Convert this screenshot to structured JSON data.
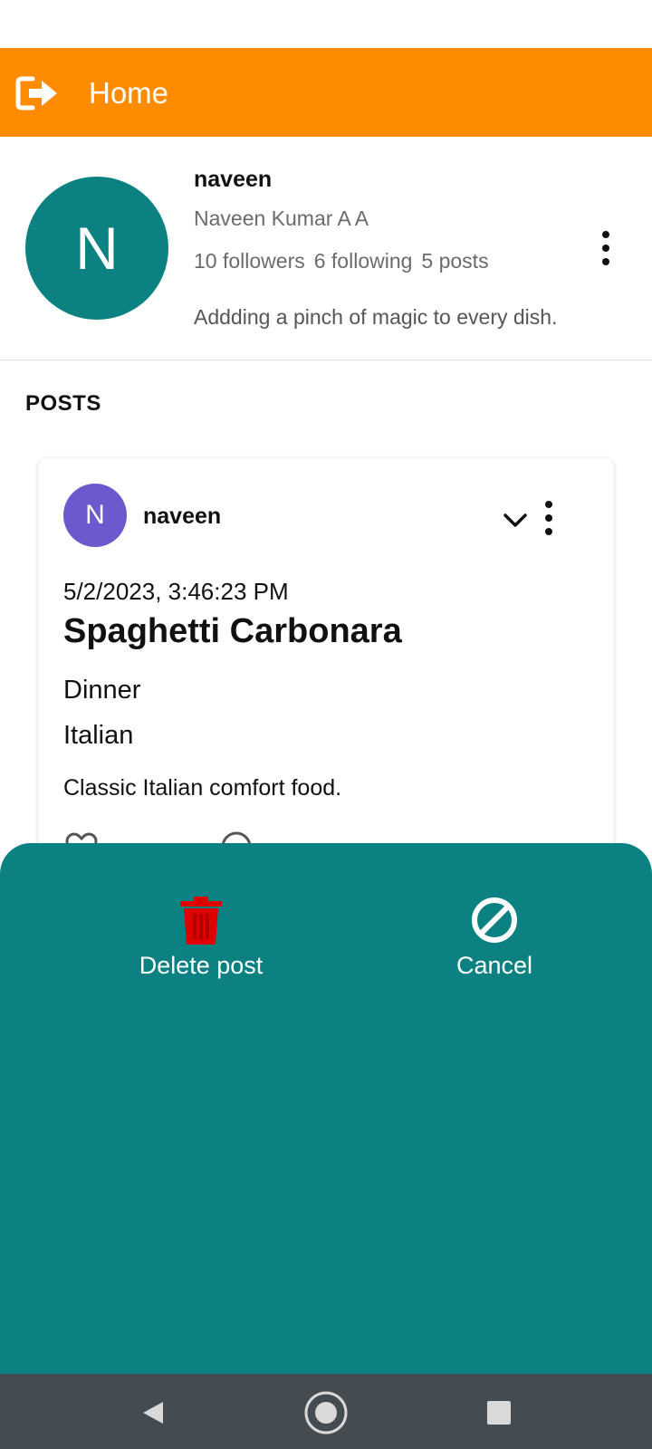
{
  "app_bar": {
    "title": "Home",
    "logout_icon": "logout-arrow-icon"
  },
  "profile": {
    "avatar_letter": "N",
    "username": "naveen",
    "full_name": "Naveen Kumar A A",
    "followers": "10 followers",
    "following": "6 following",
    "posts": "5 posts",
    "bio": "Addding a pinch of magic to every dish."
  },
  "posts_heading": "POSTS",
  "post": {
    "avatar_letter": "N",
    "username": "naveen",
    "date": "5/2/2023, 3:46:23 PM",
    "title": "Spaghetti Carbonara",
    "meal": "Dinner",
    "cuisine": "Italian",
    "description": "Classic Italian comfort food."
  },
  "sheet": {
    "delete_label": "Delete post",
    "cancel_label": "Cancel",
    "delete_color": "#e00000"
  },
  "colors": {
    "app_bar": "#ff8c00",
    "teal": "#0b8281",
    "post_avatar": "#6a5acd",
    "nav_bar": "#444b51"
  }
}
